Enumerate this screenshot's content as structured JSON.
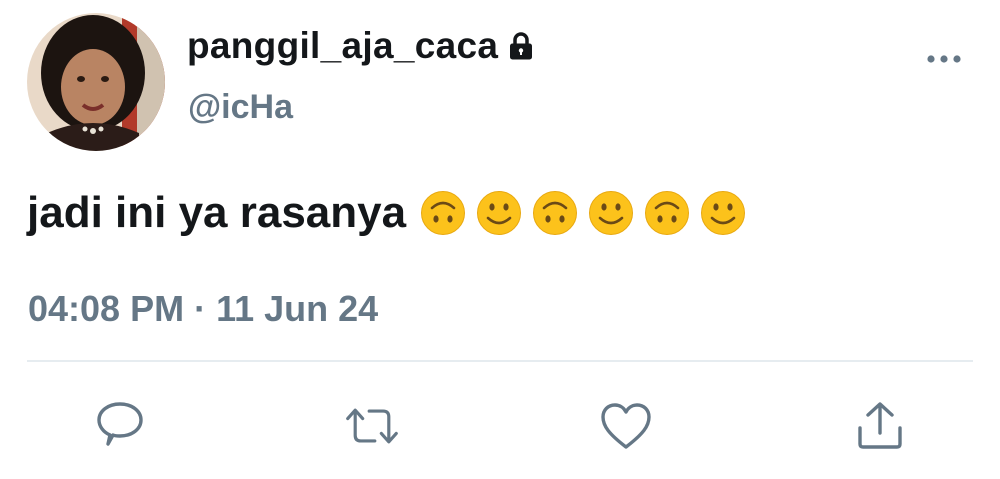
{
  "tweet": {
    "display_name": "panggil_aja_caca",
    "handle": "@icHa",
    "text": "jadi ini ya rasanya",
    "emojis": [
      "upside-down-face",
      "slightly-smiling-face",
      "upside-down-face",
      "slightly-smiling-face",
      "upside-down-face",
      "slightly-smiling-face"
    ],
    "time": "04:08 PM",
    "separator": "·",
    "date": "11 Jun 24",
    "locked": true
  },
  "icons": {
    "lock": "lock-icon",
    "more": "more-icon",
    "reply": "reply-icon",
    "retweet": "retweet-icon",
    "like": "heart-icon",
    "share": "share-icon"
  },
  "colors": {
    "text_primary": "#14171a",
    "text_secondary": "#657786",
    "icon": "#657786",
    "divider": "#e6ecf0",
    "emoji": "#fcc21b"
  }
}
